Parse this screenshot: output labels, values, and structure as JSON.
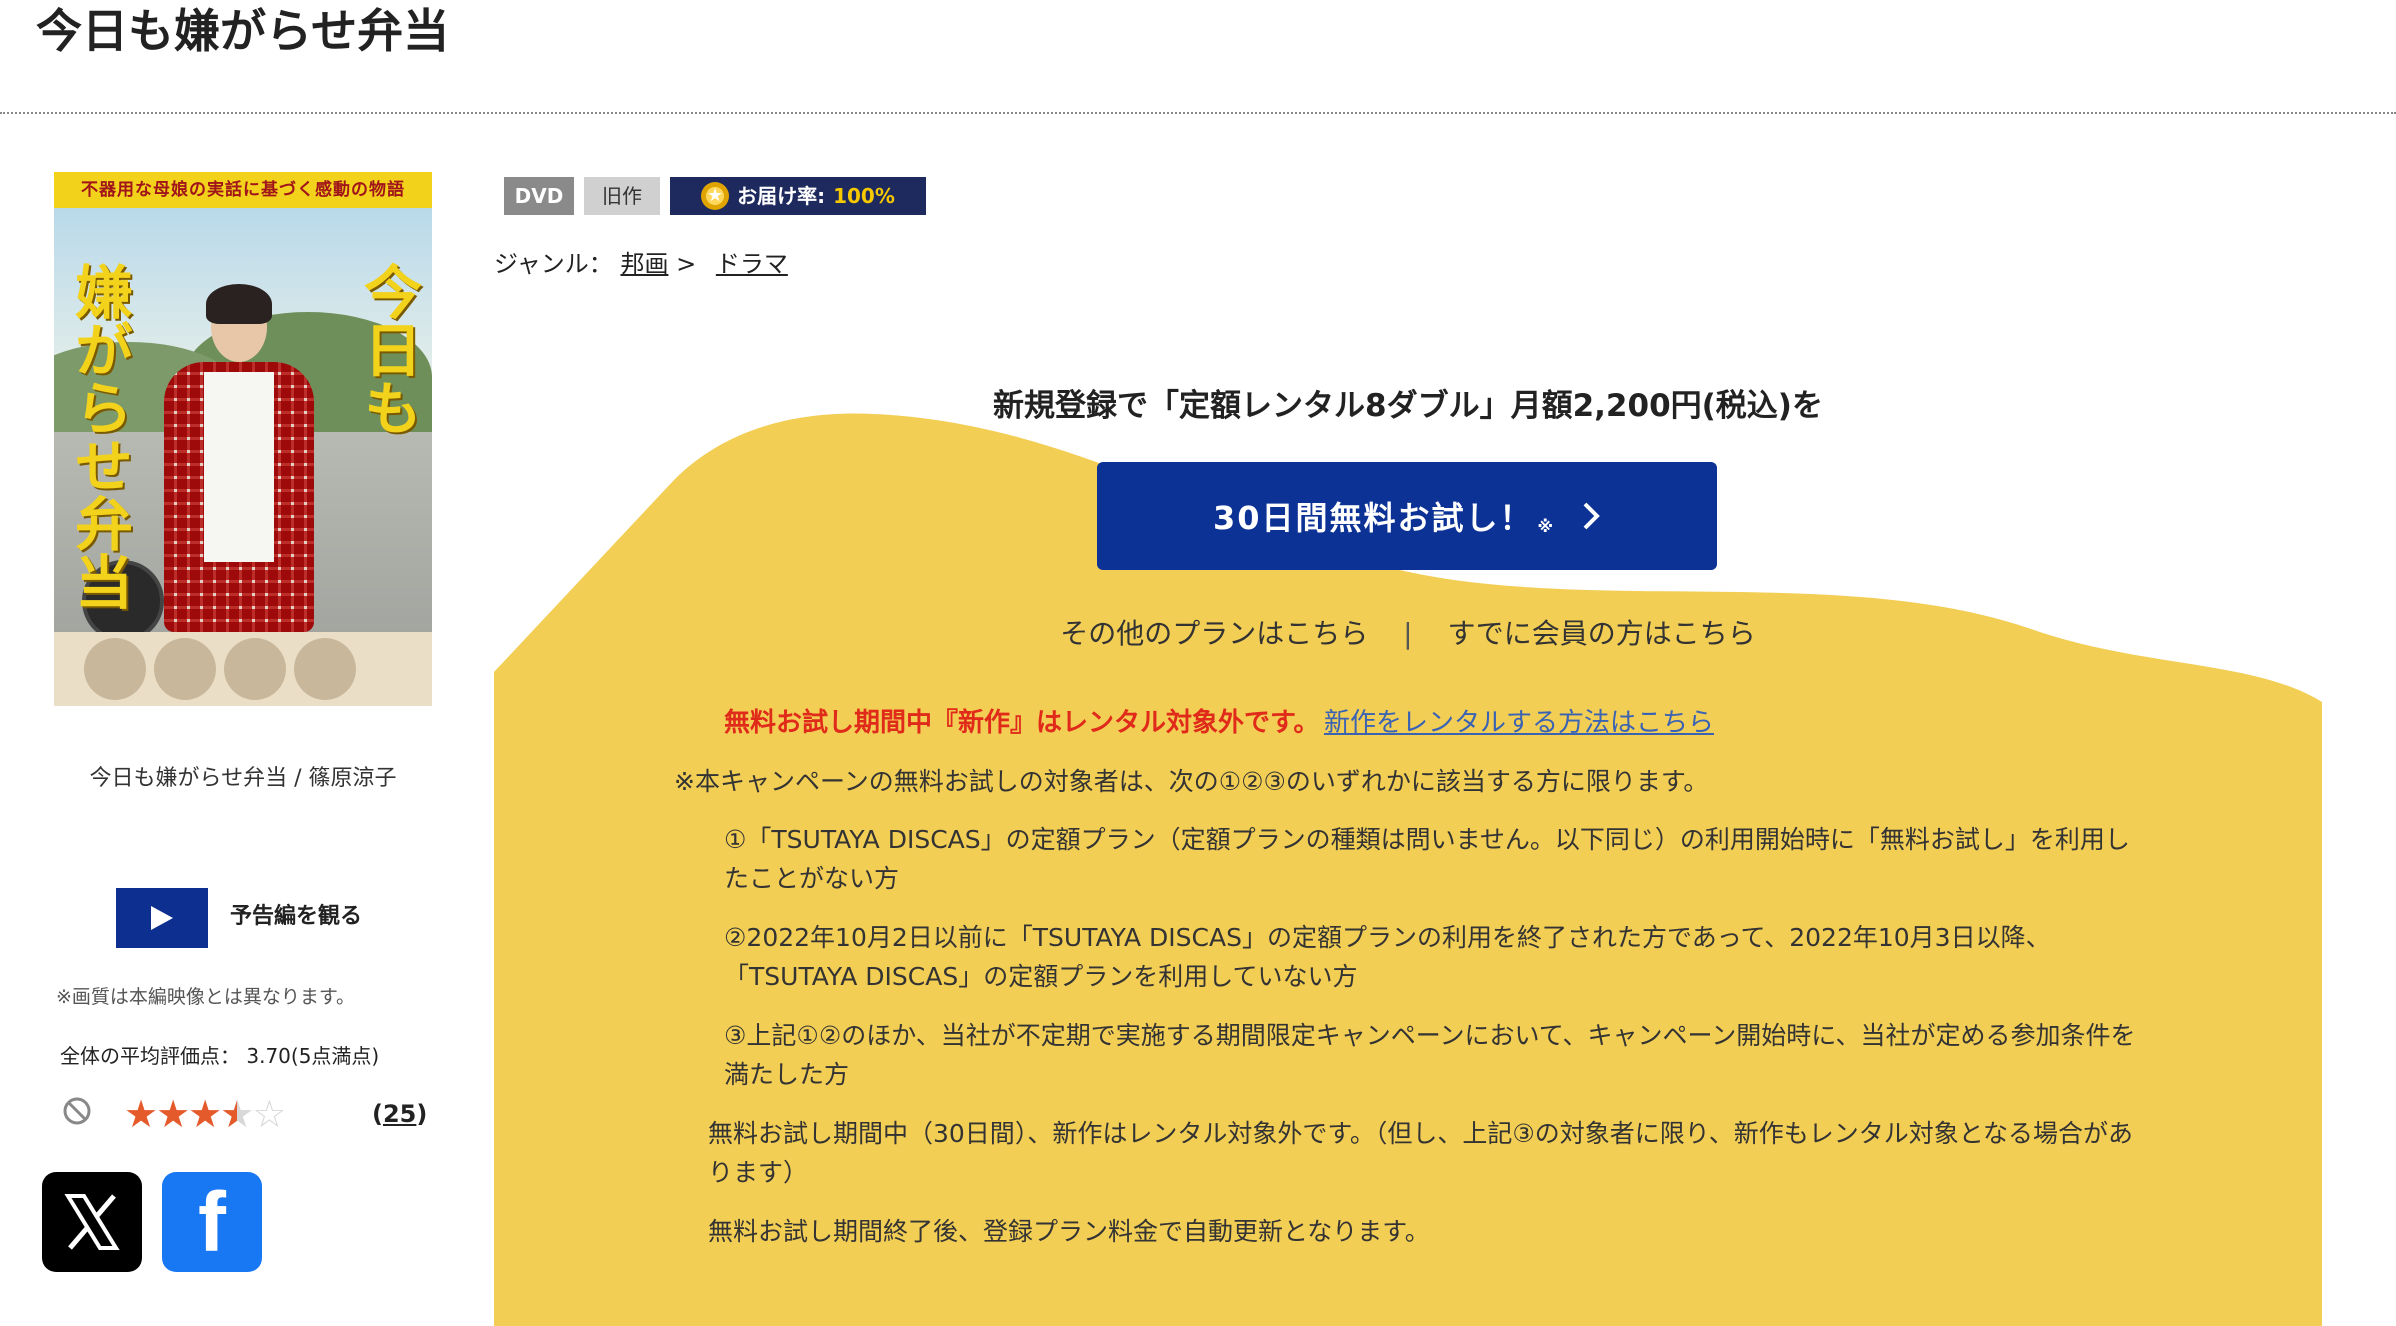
{
  "page_title": "今日も嫌がらせ弁当",
  "cover": {
    "band_text": "不器用な母娘の実話に基づく感動の物語",
    "title_text": "今日も",
    "title_text2": "嫌がらせ弁当",
    "caption": "今日も嫌がらせ弁当 / 篠原涼子"
  },
  "trailer": {
    "label": "予告編を観る",
    "note": "※画質は本編映像とは異なります。"
  },
  "rating": {
    "average_text": "全体の平均評価点： 3.70(5点満点)",
    "stars_value": 3.7,
    "review_count_open": "(",
    "review_count": "25",
    "review_count_close": ")"
  },
  "badges": {
    "format": "DVD",
    "status": "旧作",
    "delivery_label": "お届け率:",
    "delivery_rate": "100%"
  },
  "genre": {
    "label": "ジャンル：",
    "parent": "邦画",
    "separator": ">",
    "child": "ドラマ"
  },
  "campaign": {
    "signup_text": "新規登録で「定額レンタル8ダブル」月額2,200円(税込)を",
    "trial_button": "30日間無料お試し！",
    "trial_mark": "※",
    "other_plans": "その他のプランはこちら",
    "separator": "|",
    "members": "すでに会員の方はこちら",
    "warning": "無料お試し期間中『新作』はレンタル対象外です。",
    "warning_link": "新作をレンタルする方法はこちら",
    "terms": [
      "※本キャンペーンの無料お試しの対象者は、次の①②③のいずれかに該当する方に限ります。",
      "①「TSUTAYA DISCAS」の定額プラン（定額プランの種類は問いません。以下同じ）の利用開始時に「無料お試し」を利用したことがない方",
      "②2022年10月2日以前に「TSUTAYA DISCAS」の定額プランの利用を終了された方であって、2022年10月3日以降、「TSUTAYA DISCAS」の定額プランを利用していない方",
      "③上記①②のほか、当社が不定期で実施する期間限定キャンペーンにおいて、キャンペーン開始時に、当社が定める参加条件を満たした方",
      "無料お試し期間中（30日間）、新作はレンタル対象外です。（但し、上記③の対象者に限り、新作もレンタル対象となる場合があります）",
      "無料お試し期間終了後、登録プラン料金で自動更新となります。"
    ]
  },
  "colors": {
    "yellow": "#f3ce55",
    "navy": "#0d3296",
    "warning_red": "#e02b1b",
    "link_blue": "#3b63b3"
  },
  "icons": {
    "play": "play-icon",
    "x": "x-logo-icon",
    "facebook": "facebook-logo-icon",
    "disabled": "prohibited-icon",
    "chevron": "chevron-right-icon",
    "medal": "star-medal-icon"
  }
}
